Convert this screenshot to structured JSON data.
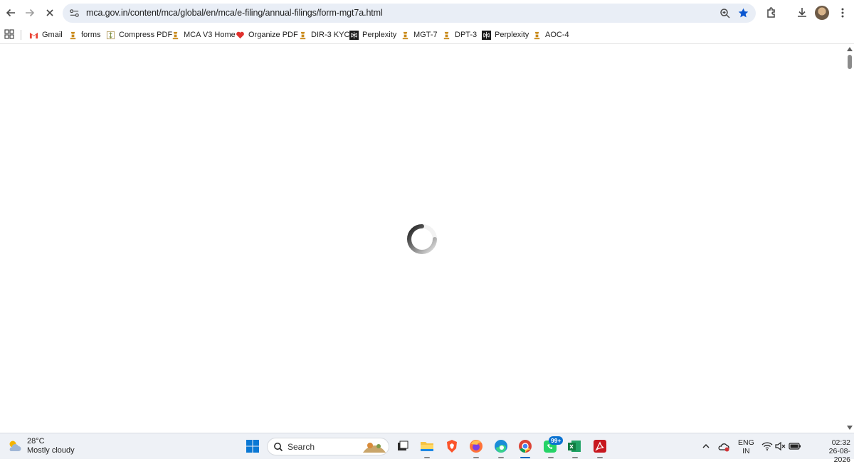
{
  "browser": {
    "url": "mca.gov.in/content/mca/global/en/mca/e-filing/annual-filings/form-mgt7a.html",
    "accent_color": "#0b57d0"
  },
  "bookmarks": [
    {
      "label": "Gmail",
      "icon": "gmail-icon"
    },
    {
      "label": "forms",
      "icon": "emblem-icon"
    },
    {
      "label": "Compress PDF",
      "icon": "compress-pdf-icon"
    },
    {
      "label": "MCA V3 Home",
      "icon": "emblem-icon"
    },
    {
      "label": "Organize PDF",
      "icon": "heart-icon"
    },
    {
      "label": "DIR-3 KYC",
      "icon": "emblem-icon"
    },
    {
      "label": "Perplexity",
      "icon": "perplexity-icon"
    },
    {
      "label": "MGT-7",
      "icon": "emblem-icon"
    },
    {
      "label": "DPT-3",
      "icon": "emblem-icon"
    },
    {
      "label": "Perplexity",
      "icon": "perplexity-icon"
    },
    {
      "label": "AOC-4",
      "icon": "emblem-icon"
    }
  ],
  "page": {
    "state": "loading",
    "spinner_icon": "loading-spinner-icon"
  },
  "taskbar": {
    "weather": {
      "temperature": "28°C",
      "condition": "Mostly cloudy"
    },
    "search_placeholder": "Search",
    "apps": [
      "start-icon",
      "search",
      "task-view-icon",
      "file-explorer-icon",
      "brave-icon",
      "firefox-icon",
      "edge-icon",
      "chrome-icon",
      "whatsapp-icon",
      "excel-icon",
      "acrobat-icon"
    ],
    "whatsapp_badge": "99+",
    "language": {
      "line1": "ENG",
      "line2": "IN"
    },
    "clock": {
      "time": "02:32",
      "date": "26-08-2026"
    }
  }
}
